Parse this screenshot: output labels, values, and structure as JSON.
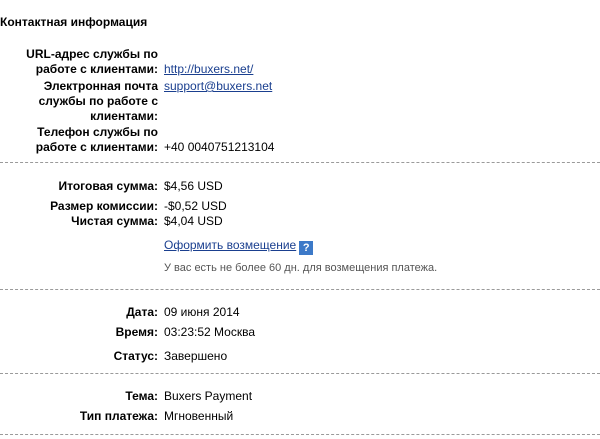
{
  "contact": {
    "title": "Контактная информация",
    "url_label_l1": "URL-адрес службы по",
    "url_label_l2": "работе с клиентами:",
    "url_value": "http://buxers.net/",
    "email_label_l1": "Электронная почта",
    "email_label_l2": "службы по работе с",
    "email_label_l3": "клиентами:",
    "email_value": "support@buxers.net",
    "phone_label_l1": "Телефон службы по",
    "phone_label_l2": "работе с клиентами:",
    "phone_value": "+40 0040751213104"
  },
  "amounts": {
    "total_label": "Итоговая сумма:",
    "total_value": "$4,56 USD",
    "fee_label": "Размер комиссии:",
    "fee_value": "-$0,52 USD",
    "net_label": "Чистая сумма:",
    "net_value": "$4,04 USD",
    "refund_link": "Оформить возмещение",
    "help_icon": "question-icon",
    "help_glyph": "?",
    "refund_note": "У вас есть не более 60 дн. для возмещения платежа."
  },
  "details": {
    "date_label": "Дата:",
    "date_value": "09 июня 2014",
    "time_label": "Время:",
    "time_value": "03:23:52 Москва",
    "status_label": "Статус:",
    "status_value": "Завершено"
  },
  "payment": {
    "subject_label": "Тема:",
    "subject_value": "Buxers Payment",
    "type_label": "Тип платежа:",
    "type_value": "Мгновенный"
  },
  "colors": {
    "link": "#1a3f8f",
    "help_icon_bg": "#3c79c8",
    "divider": "#9a9a9a"
  }
}
